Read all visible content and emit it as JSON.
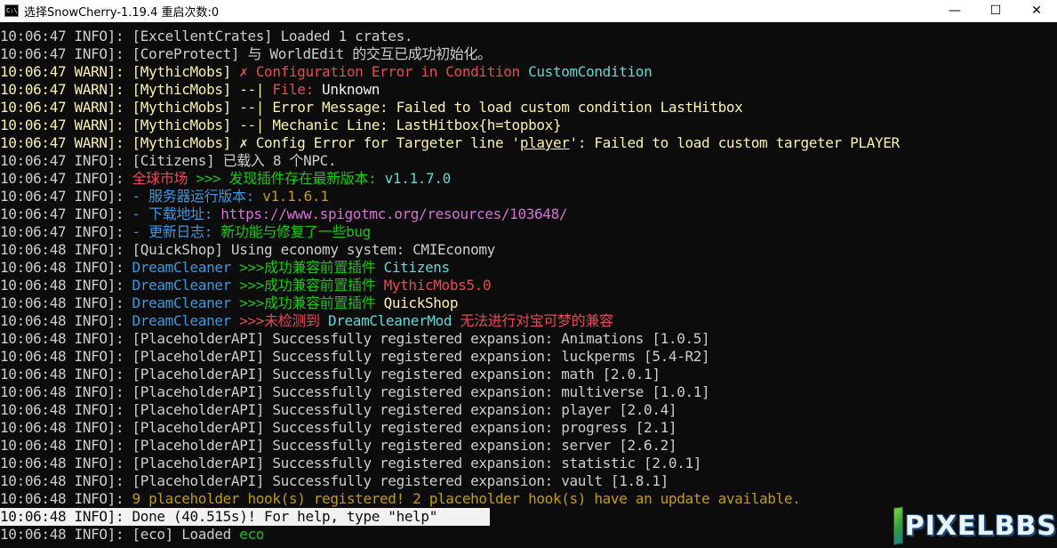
{
  "window": {
    "title": "选择SnowCherry-1.19.4 重启次数:0",
    "icon_text": "C:\\",
    "minimize_glyph": "—",
    "maximize_glyph": "☐",
    "close_glyph": "✕"
  },
  "colors": {
    "background": "#0c0c0c",
    "default_text": "#cccccc",
    "warn": "#c19c00",
    "red": "#e74856",
    "aqua": "#3a96dd",
    "cyan": "#61d6d6",
    "green": "#16c60c",
    "lime": "#13a10e",
    "yellow": "#f9f1a5",
    "gold": "#c19c00",
    "magenta": "#b4009e",
    "pink": "#d670d6",
    "white": "#f2f2f2"
  },
  "lines": [
    {
      "segments": [
        {
          "text": "10:06:47 INFO]: [ExcellentCrates] Loaded 1 crates.",
          "color": "#cccccc"
        }
      ]
    },
    {
      "segments": [
        {
          "text": "10:06:47 INFO]: [CoreProtect] 与 WorldEdit 的交互已成功初始化。",
          "color": "#cccccc"
        }
      ]
    },
    {
      "segments": [
        {
          "text": "10:06:47 WARN]: [MythicMobs] ",
          "color": "#f9f1a5"
        },
        {
          "text": "✗ Configuration Error in Condition ",
          "color": "#e74856"
        },
        {
          "text": "CustomCondition",
          "color": "#61d6d6"
        }
      ]
    },
    {
      "segments": [
        {
          "text": "10:06:47 WARN]: [MythicMobs] --| ",
          "color": "#f9f1a5"
        },
        {
          "text": "File: ",
          "color": "#e74856"
        },
        {
          "text": "Unknown",
          "color": "#f2f2f2"
        }
      ]
    },
    {
      "segments": [
        {
          "text": "10:06:47 WARN]: [MythicMobs] --| ",
          "color": "#f9f1a5"
        },
        {
          "text": "Error Message: Failed to load custom condition LastHitbox",
          "color": "#f9f1a5"
        }
      ]
    },
    {
      "segments": [
        {
          "text": "10:06:47 WARN]: [MythicMobs] --| ",
          "color": "#f9f1a5"
        },
        {
          "text": "Mechanic Line: LastHitbox{h=topbox}",
          "color": "#f9f1a5"
        }
      ]
    },
    {
      "segments": [
        {
          "text": "10:06:47 WARN]: [MythicMobs] ✗ Config Error for Targeter line '",
          "color": "#f9f1a5"
        },
        {
          "text": "player",
          "color": "#f9f1a5",
          "underline": true
        },
        {
          "text": "': Failed to load custom targeter PLAYER",
          "color": "#f9f1a5"
        }
      ]
    },
    {
      "segments": [
        {
          "text": "10:06:47 INFO]: [Citizens] 已载入 8 个NPC.",
          "color": "#cccccc"
        }
      ]
    },
    {
      "segments": [
        {
          "text": "10:06:47 INFO]: ",
          "color": "#cccccc"
        },
        {
          "text": "全球市场 ",
          "color": "#e74856"
        },
        {
          "text": ">>> 发现插件存在最新版本: ",
          "color": "#16c60c"
        },
        {
          "text": "v1.1.7.0",
          "color": "#61d6d6"
        }
      ]
    },
    {
      "segments": [
        {
          "text": "10:06:47 INFO]: ",
          "color": "#cccccc"
        },
        {
          "text": "- 服务器运行版本: ",
          "color": "#3a96dd"
        },
        {
          "text": "v1.1.6.1",
          "color": "#c19c00"
        }
      ]
    },
    {
      "segments": [
        {
          "text": "10:06:47 INFO]: ",
          "color": "#cccccc"
        },
        {
          "text": "- 下载地址: ",
          "color": "#3a96dd"
        },
        {
          "text": "https://www.spigotmc.org/resources/103648/",
          "color": "#d670d6"
        }
      ]
    },
    {
      "segments": [
        {
          "text": "10:06:47 INFO]: ",
          "color": "#cccccc"
        },
        {
          "text": "- 更新日志: ",
          "color": "#3a96dd"
        },
        {
          "text": "新功能与修复了一些bug",
          "color": "#16c60c"
        }
      ]
    },
    {
      "segments": [
        {
          "text": "10:06:48 INFO]: [QuickShop] Using economy system: CMIEconomy",
          "color": "#cccccc"
        }
      ]
    },
    {
      "segments": [
        {
          "text": "10:06:48 INFO]: ",
          "color": "#cccccc"
        },
        {
          "text": "DreamCleaner ",
          "color": "#3a96dd"
        },
        {
          "text": ">>>成功兼容前置插件 ",
          "color": "#16c60c"
        },
        {
          "text": "Citizens",
          "color": "#61d6d6"
        }
      ]
    },
    {
      "segments": [
        {
          "text": "10:06:48 INFO]: ",
          "color": "#cccccc"
        },
        {
          "text": "DreamCleaner ",
          "color": "#3a96dd"
        },
        {
          "text": ">>>成功兼容前置插件 ",
          "color": "#16c60c"
        },
        {
          "text": "MythicMobs5.0",
          "color": "#e74856"
        }
      ]
    },
    {
      "segments": [
        {
          "text": "10:06:48 INFO]: ",
          "color": "#cccccc"
        },
        {
          "text": "DreamCleaner ",
          "color": "#3a96dd"
        },
        {
          "text": ">>>成功兼容前置插件 ",
          "color": "#16c60c"
        },
        {
          "text": "QuickShop",
          "color": "#f9f1a5"
        }
      ]
    },
    {
      "segments": [
        {
          "text": "10:06:48 INFO]: ",
          "color": "#cccccc"
        },
        {
          "text": "DreamCleaner ",
          "color": "#3a96dd"
        },
        {
          "text": ">>>未检测到 ",
          "color": "#e74856"
        },
        {
          "text": "DreamCleanerMod ",
          "color": "#61d6d6"
        },
        {
          "text": "无法进行对宝可梦的兼容",
          "color": "#e74856"
        }
      ]
    },
    {
      "segments": [
        {
          "text": "10:06:48 INFO]: [PlaceholderAPI] Successfully registered expansion: Animations [1.0.5]",
          "color": "#cccccc"
        }
      ]
    },
    {
      "segments": [
        {
          "text": "10:06:48 INFO]: [PlaceholderAPI] Successfully registered expansion: luckperms [5.4-R2]",
          "color": "#cccccc"
        }
      ]
    },
    {
      "segments": [
        {
          "text": "10:06:48 INFO]: [PlaceholderAPI] Successfully registered expansion: math [2.0.1]",
          "color": "#cccccc"
        }
      ]
    },
    {
      "segments": [
        {
          "text": "10:06:48 INFO]: [PlaceholderAPI] Successfully registered expansion: multiverse [1.0.1]",
          "color": "#cccccc"
        }
      ]
    },
    {
      "segments": [
        {
          "text": "10:06:48 INFO]: [PlaceholderAPI] Successfully registered expansion: player [2.0.4]",
          "color": "#cccccc"
        }
      ]
    },
    {
      "segments": [
        {
          "text": "10:06:48 INFO]: [PlaceholderAPI] Successfully registered expansion: progress [2.1]",
          "color": "#cccccc"
        }
      ]
    },
    {
      "segments": [
        {
          "text": "10:06:48 INFO]: [PlaceholderAPI] Successfully registered expansion: server [2.6.2]",
          "color": "#cccccc"
        }
      ]
    },
    {
      "segments": [
        {
          "text": "10:06:48 INFO]: [PlaceholderAPI] Successfully registered expansion: statistic [2.0.1]",
          "color": "#cccccc"
        }
      ]
    },
    {
      "segments": [
        {
          "text": "10:06:48 INFO]: [PlaceholderAPI] Successfully registered expansion: vault [1.8.1]",
          "color": "#cccccc"
        }
      ]
    },
    {
      "segments": [
        {
          "text": "10:06:48 INFO]: ",
          "color": "#cccccc"
        },
        {
          "text": "9 placeholder hook(s) registered! 2 placeholder hook(s) have an update available.",
          "color": "#c19c00"
        }
      ]
    },
    {
      "selected": true,
      "segments": [
        {
          "text": "10:06:48 INFO]: Done (40.515s)! For help, type \"help\"",
          "color": "#0c0c0c"
        }
      ]
    },
    {
      "segments": [
        {
          "text": "10:06:48 INFO]: [eco] Loaded ",
          "color": "#cccccc"
        },
        {
          "text": "eco",
          "color": "#16c60c"
        }
      ]
    }
  ],
  "watermark": {
    "text": "PIXELBBS"
  }
}
